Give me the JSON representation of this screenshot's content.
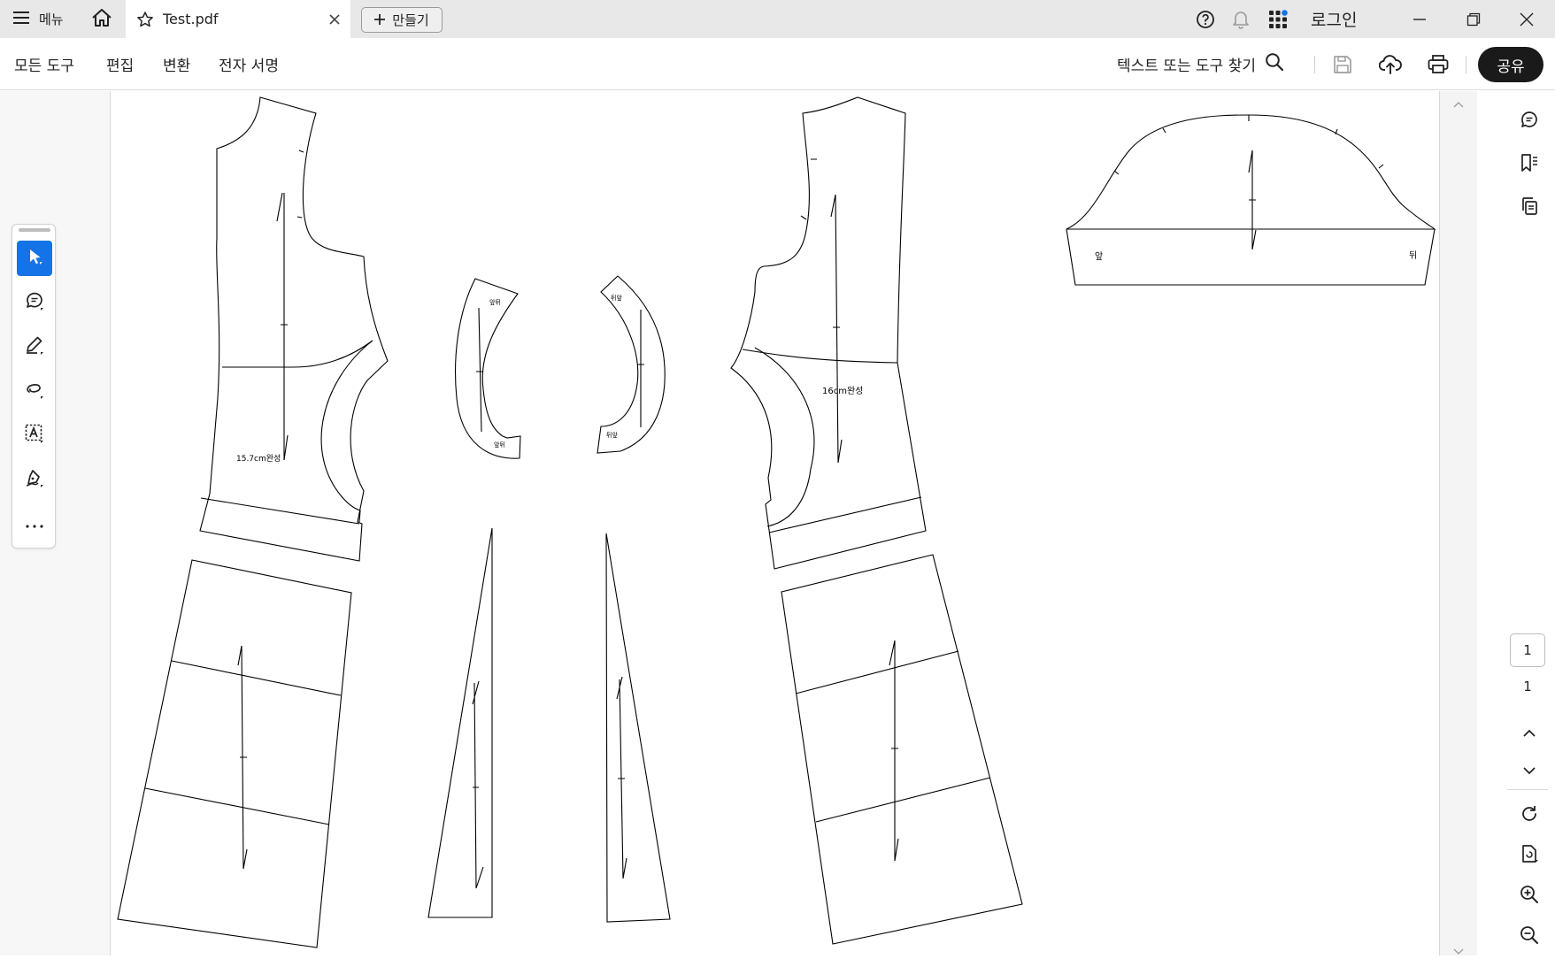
{
  "titlebar": {
    "menu_label": "메뉴",
    "tab_title": "Test.pdf",
    "new_tab_label": "만들기",
    "login_label": "로그인"
  },
  "toolbar": {
    "menus": [
      "모든 도구",
      "편집",
      "변환",
      "전자 서명"
    ],
    "search_label": "텍스트 또는 도구 찾기",
    "share_label": "공유"
  },
  "navigation": {
    "current_page": "1",
    "total_pages": "1"
  },
  "document": {
    "labels": {
      "front_bodice_measure": "15.7cm완성",
      "back_bodice_measure": "16cm완성",
      "sleeve_front": "앞",
      "sleeve_back": "뒤",
      "facing_front_top": "앞뒤",
      "facing_front_bottom": "앞뒤",
      "facing_back_top": "뒤앞",
      "facing_back_bottom": "뒤앞"
    }
  },
  "colors": {
    "accent": "#1473e6",
    "share_bg": "#1a1a1a",
    "titlebar_bg": "#e8e8e8",
    "notification_dot": "#1473e6"
  }
}
